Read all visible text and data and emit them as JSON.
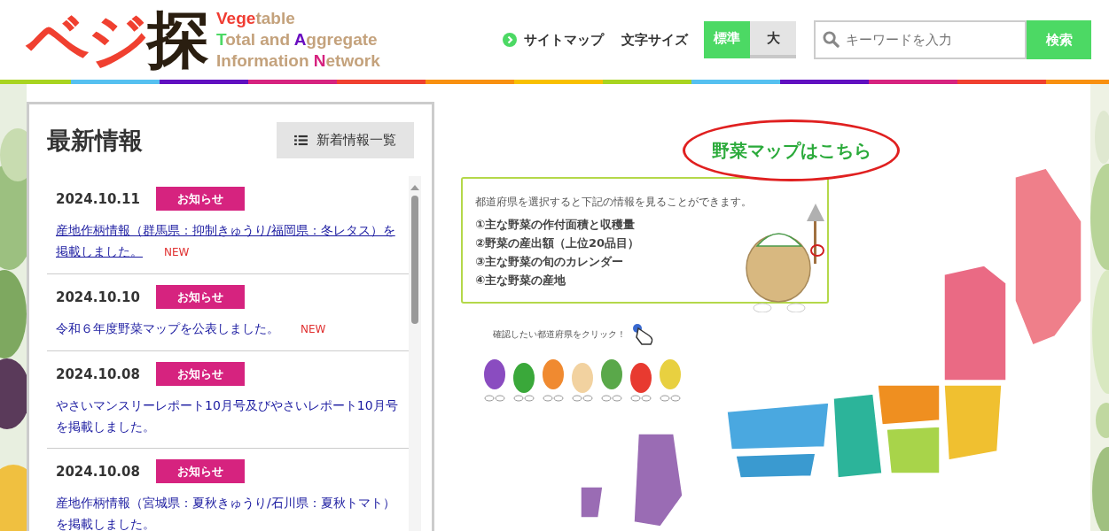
{
  "header": {
    "logo": {
      "mark": [
        {
          "text": "ベジ",
          "color": "#f04030"
        },
        {
          "text": "探",
          "color": "#2a1e10"
        }
      ],
      "lines": [
        [
          {
            "text": "Vege",
            "color": "#f03c32"
          },
          {
            "text": "table",
            "color": "#c4a27c"
          }
        ],
        [
          {
            "text": "T",
            "color": "#4cd964"
          },
          {
            "text": "otal and ",
            "color": "#c4a27c"
          },
          {
            "text": "A",
            "color": "#6a0dc0"
          },
          {
            "text": "ggregate",
            "color": "#c4a27c"
          }
        ],
        [
          {
            "text": "Information ",
            "color": "#c4a27c"
          },
          {
            "text": "N",
            "color": "#d6237f"
          },
          {
            "text": "etwork",
            "color": "#c4a27c"
          }
        ]
      ]
    },
    "sitemap": "サイトマップ",
    "font_size_label": "文字サイズ",
    "font_sizes": [
      {
        "label": "標準",
        "selected": true
      },
      {
        "label": "大",
        "selected": false
      }
    ],
    "search": {
      "placeholder": "キーワードを入力",
      "button": "検索"
    }
  },
  "news": {
    "title": "最新情報",
    "list_button": "新着情報一覧",
    "items": [
      {
        "date": "2024.10.11",
        "tag": "お知らせ",
        "text": "産地作柄情報（群馬県：抑制きゅうり/福岡県：冬レタス）を掲載しました。",
        "badge": "NEW",
        "hovered": true
      },
      {
        "date": "2024.10.10",
        "tag": "お知らせ",
        "text": "令和６年度野菜マップを公表しました。",
        "badge": "NEW",
        "hovered": false
      },
      {
        "date": "2024.10.08",
        "tag": "お知らせ",
        "text": "やさいマンスリーレポート10月号及びやさいレポート10月号を掲載しました。",
        "hovered": false
      },
      {
        "date": "2024.10.08",
        "tag": "お知らせ",
        "text": "産地作柄情報（宮城県：夏秋きゅうり/石川県：夏秋トマト）を掲載しました。",
        "hovered": false
      }
    ]
  },
  "map_banner": {
    "callout": "野菜マップはこちら",
    "intro": "都道府県を選択すると下記の情報を見ることができます。",
    "items": [
      "①主な野菜の作付面積と収穫量",
      "②野菜の産出額（上位20品目）",
      "③主な野菜の旬のカレンダー",
      "④主な野菜の産地"
    ],
    "click_prompt": "確認したい都道府県をクリック！"
  }
}
